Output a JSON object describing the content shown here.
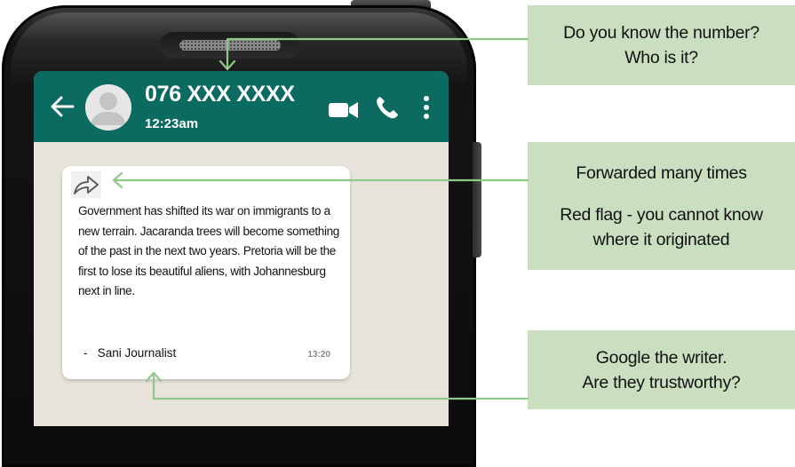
{
  "chat": {
    "contact_name": "076 XXX XXXX",
    "contact_time": "12:23am",
    "message": {
      "text": "Government has shifted its war on immigrants to a new terrain. Jacaranda trees will become something of the past in the next two years. Pretoria will be the first to lose its beautiful aliens, with Johannesburg next in line.",
      "author": "-   Sani Journalist",
      "time": "13:20"
    },
    "icons": {
      "back": "arrow-left-icon",
      "avatar": "user-avatar-icon",
      "video": "video-camera-icon",
      "call": "phone-icon",
      "more": "more-vertical-icon",
      "forwarded": "forwarded-arrow-icon"
    },
    "colors": {
      "header": "#0c6b60",
      "chat_background": "#e8e4dc",
      "note_background": "#c9dfc0",
      "connector": "#8fc98a"
    }
  },
  "annotations": {
    "number": {
      "line1": "Do you know the number?",
      "line2": "Who is it?"
    },
    "forwarded": {
      "line1": "Forwarded many times",
      "line2": "Red flag - you cannot know",
      "line3": "where it originated"
    },
    "writer": {
      "line1": "Google the writer.",
      "line2": "Are they trustworthy?"
    }
  }
}
